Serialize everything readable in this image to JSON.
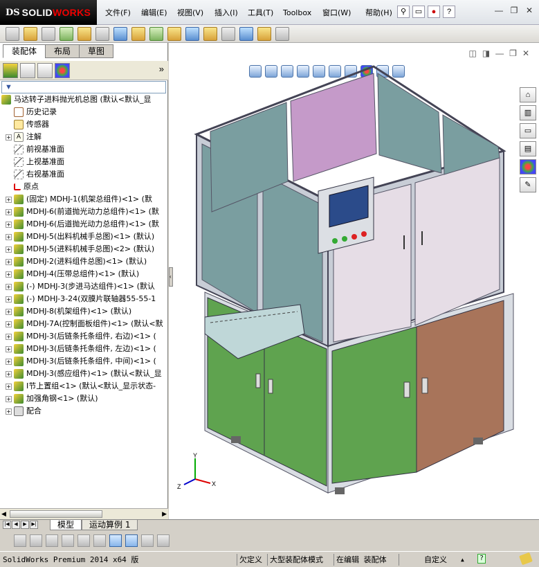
{
  "app": {
    "logo_prefix": "DS",
    "logo_solid": "SOLID",
    "logo_works": "WORKS"
  },
  "menu": [
    "文件(F)",
    "编辑(E)",
    "视图(V)",
    "插入(I)",
    "工具(T)",
    "Toolbox",
    "窗口(W)",
    "帮助(H)"
  ],
  "window_buttons": {
    "minimize": "—",
    "restore": "❐",
    "close": "✕"
  },
  "panel_tabs": [
    "装配体",
    "布局",
    "草图"
  ],
  "panel_more": "»",
  "filter_icon": "filter-icon",
  "tree": [
    {
      "label": "马达转子进料抛光机总图  (默认<默认_显",
      "icon": "assembly-icon",
      "expand": ""
    },
    {
      "label": "历史记录",
      "icon": "history-icon",
      "expand": ""
    },
    {
      "label": "传感器",
      "icon": "sensor-icon",
      "expand": ""
    },
    {
      "label": "注解",
      "icon": "annotation-icon",
      "expand": "+"
    },
    {
      "label": "前视基准面",
      "icon": "plane-icon",
      "expand": ""
    },
    {
      "label": "上视基准面",
      "icon": "plane-icon",
      "expand": ""
    },
    {
      "label": "右视基准面",
      "icon": "plane-icon",
      "expand": ""
    },
    {
      "label": "原点",
      "icon": "origin-icon",
      "expand": ""
    },
    {
      "label": "(固定) MDHJ-1(机架总组件)<1> (默",
      "icon": "assembly-icon",
      "expand": "+"
    },
    {
      "label": "MDHJ-6(前道抛光动力总组件)<1> (默",
      "icon": "assembly-icon",
      "expand": "+"
    },
    {
      "label": "MDHJ-6(后道抛光动力总组件)<1> (默",
      "icon": "assembly-icon",
      "expand": "+"
    },
    {
      "label": "MDHJ-5(出料机械手总图)<1> (默认)",
      "icon": "assembly-icon",
      "expand": "+"
    },
    {
      "label": "MDHJ-5(进料机械手总图)<2> (默认)",
      "icon": "assembly-icon",
      "expand": "+"
    },
    {
      "label": "MDHJ-2(进料组件总图)<1> (默认)",
      "icon": "assembly-icon",
      "expand": "+"
    },
    {
      "label": "MDHJ-4(压带总组件)<1> (默认)",
      "icon": "assembly-icon",
      "expand": "+"
    },
    {
      "label": "(-) MDHJ-3(步进马达组件)<1> (默认",
      "icon": "assembly-icon",
      "expand": "+"
    },
    {
      "label": "(-) MDHJ-3-24(双膜片联轴器55-55-1",
      "icon": "assembly-icon",
      "expand": "+"
    },
    {
      "label": "MDHJ-8(机架组件)<1> (默认)",
      "icon": "assembly-icon",
      "expand": "+"
    },
    {
      "label": "MDHJ-7A(控制面板组件)<1> (默认<默",
      "icon": "assembly-icon",
      "expand": "+"
    },
    {
      "label": "MDHJ-3(后链条托条组件, 右边)<1> (",
      "icon": "assembly-icon",
      "expand": "+"
    },
    {
      "label": "MDHJ-3(后链条托条组件, 左边)<1> (",
      "icon": "assembly-icon",
      "expand": "+"
    },
    {
      "label": "MDHJ-3(后链条托条组件, 中间)<1> (",
      "icon": "assembly-icon",
      "expand": "+"
    },
    {
      "label": "MDHJ-3(感应组件)<1> (默认<默认_显",
      "icon": "assembly-icon",
      "expand": "+"
    },
    {
      "label": "I节上置组<1> (默认<默认_显示状态-",
      "icon": "assembly-icon",
      "expand": "+"
    },
    {
      "label": "加强角钢<1> (默认)",
      "icon": "assembly-icon",
      "expand": "+"
    },
    {
      "label": "配合",
      "icon": "mates-icon",
      "expand": "+"
    }
  ],
  "bottom_tabs": [
    "模型",
    "运动算例 1"
  ],
  "status": {
    "app_version": "SolidWorks Premium 2014 x64 版",
    "underdefined": "欠定义",
    "large_asm": "大型装配体模式",
    "editing": "在编辑 装配体",
    "custom": "自定义",
    "up": "▲",
    "help": "?"
  },
  "axes": {
    "x": "X",
    "y": "Y",
    "z": "Z"
  },
  "colors": {
    "frame": "#c8cdd6",
    "green_panel": "#5fa34f",
    "brown_panel": "#a8745a",
    "pink_glass": "#c59ac9",
    "teal_glass": "#7a9ea0",
    "light_glass": "#e6dde6"
  }
}
